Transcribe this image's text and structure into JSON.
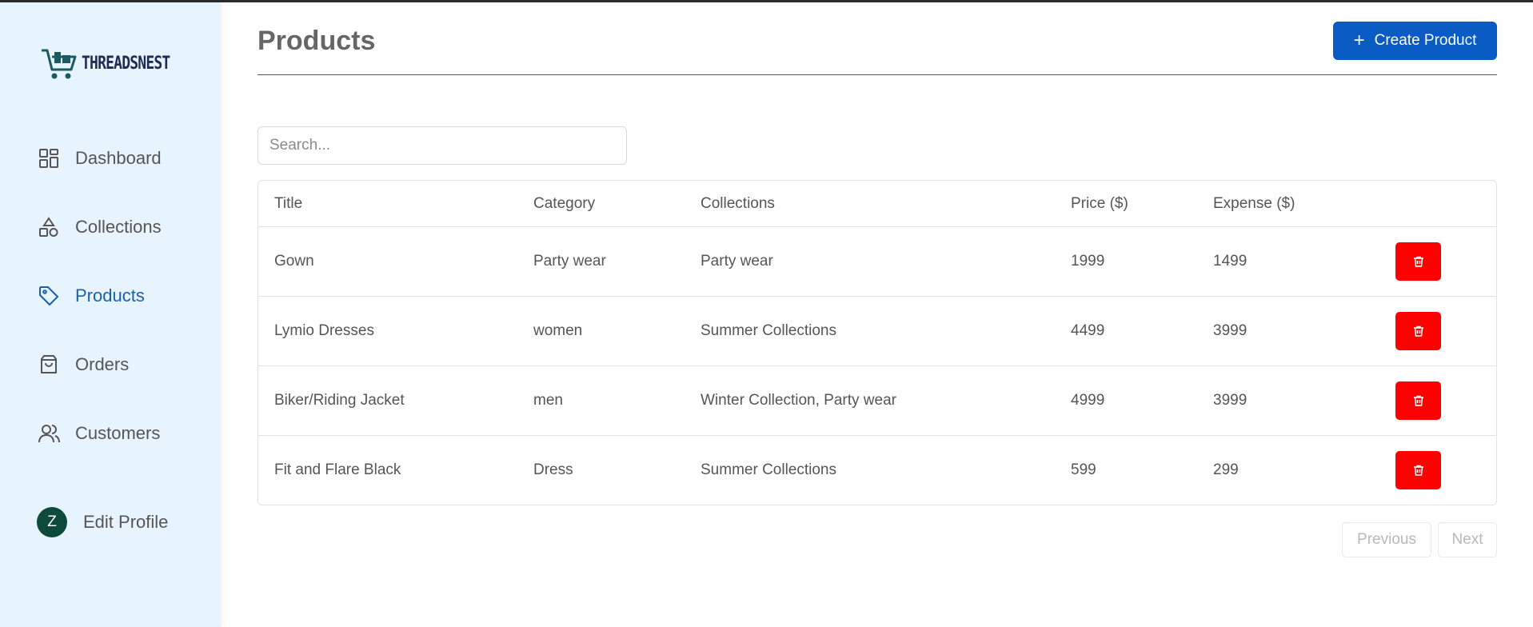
{
  "brand": {
    "name": "THREADSNEST",
    "colors": {
      "sidebar_bg": "#e8f4fd",
      "accent": "#0a5bc4",
      "active_nav": "#1b5fb0",
      "danger": "#fe0000",
      "avatar": "#0e4a3c"
    }
  },
  "sidebar": {
    "items": [
      {
        "label": "Dashboard",
        "icon": "dashboard-grid-icon",
        "active": false
      },
      {
        "label": "Collections",
        "icon": "shapes-icon",
        "active": false
      },
      {
        "label": "Products",
        "icon": "tag-icon",
        "active": true
      },
      {
        "label": "Orders",
        "icon": "shopping-bag-icon",
        "active": false
      },
      {
        "label": "Customers",
        "icon": "users-icon",
        "active": false
      }
    ],
    "profile": {
      "avatar_letter": "Z",
      "label": "Edit Profile"
    }
  },
  "header": {
    "title": "Products",
    "create_label": "Create Product"
  },
  "search": {
    "placeholder": "Search...",
    "value": ""
  },
  "table": {
    "columns": [
      "Title",
      "Category",
      "Collections",
      "Price ($)",
      "Expense ($)"
    ],
    "rows": [
      {
        "title": "Gown",
        "category": "Party wear",
        "collections": "Party wear",
        "price": "1999",
        "expense": "1499"
      },
      {
        "title": "Lymio Dresses",
        "category": "women",
        "collections": "Summer Collections",
        "price": "4499",
        "expense": "3999"
      },
      {
        "title": "Biker/Riding Jacket",
        "category": "men",
        "collections": "Winter Collection, Party wear",
        "price": "4999",
        "expense": "3999"
      },
      {
        "title": "Fit and Flare Black",
        "category": "Dress",
        "collections": "Summer Collections",
        "price": "599",
        "expense": "299"
      }
    ]
  },
  "pagination": {
    "previous_label": "Previous",
    "next_label": "Next"
  }
}
